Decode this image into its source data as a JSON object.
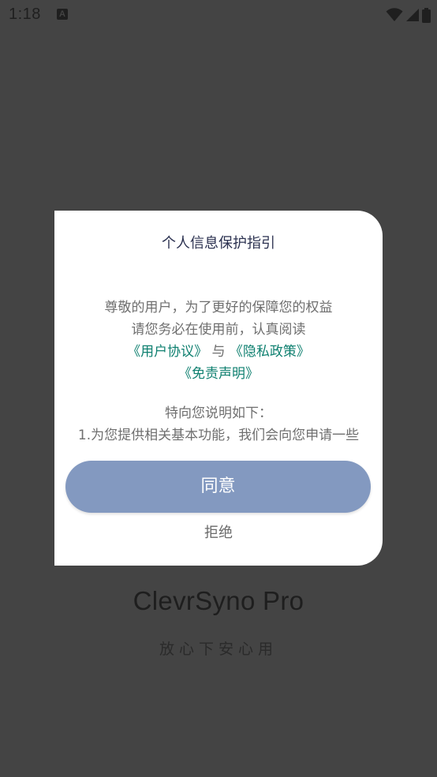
{
  "status_bar": {
    "time": "1:18",
    "notification_icon": "A"
  },
  "background": {
    "app_name": "ClevrSyno Pro",
    "slogan": "放心下安心用"
  },
  "dialog": {
    "title": "个人信息保护指引",
    "body": {
      "line1": "尊敬的用户，为了更好的保障您的权益",
      "line2": "请您务必在使用前，认真阅读",
      "user_agreement_link": "《用户协议》",
      "and_text": " 与 ",
      "privacy_policy_link": "《隐私政策》",
      "disclaimer_link": "《免责声明》",
      "line5": "特向您说明如下：",
      "line6": "1.为您提供相关基本功能，我们会向您申请一些"
    },
    "agree_label": "同意",
    "reject_label": "拒绝"
  },
  "colors": {
    "overlay_background": "#444444",
    "dialog_background": "#ffffff",
    "link": "#0f8070",
    "agree_button": "#8399c0",
    "title": "#2b3150"
  },
  "icons": {
    "notification": "app-notification-icon",
    "wifi": "wifi-icon",
    "signal": "cellular-signal-icon",
    "battery": "battery-icon"
  }
}
